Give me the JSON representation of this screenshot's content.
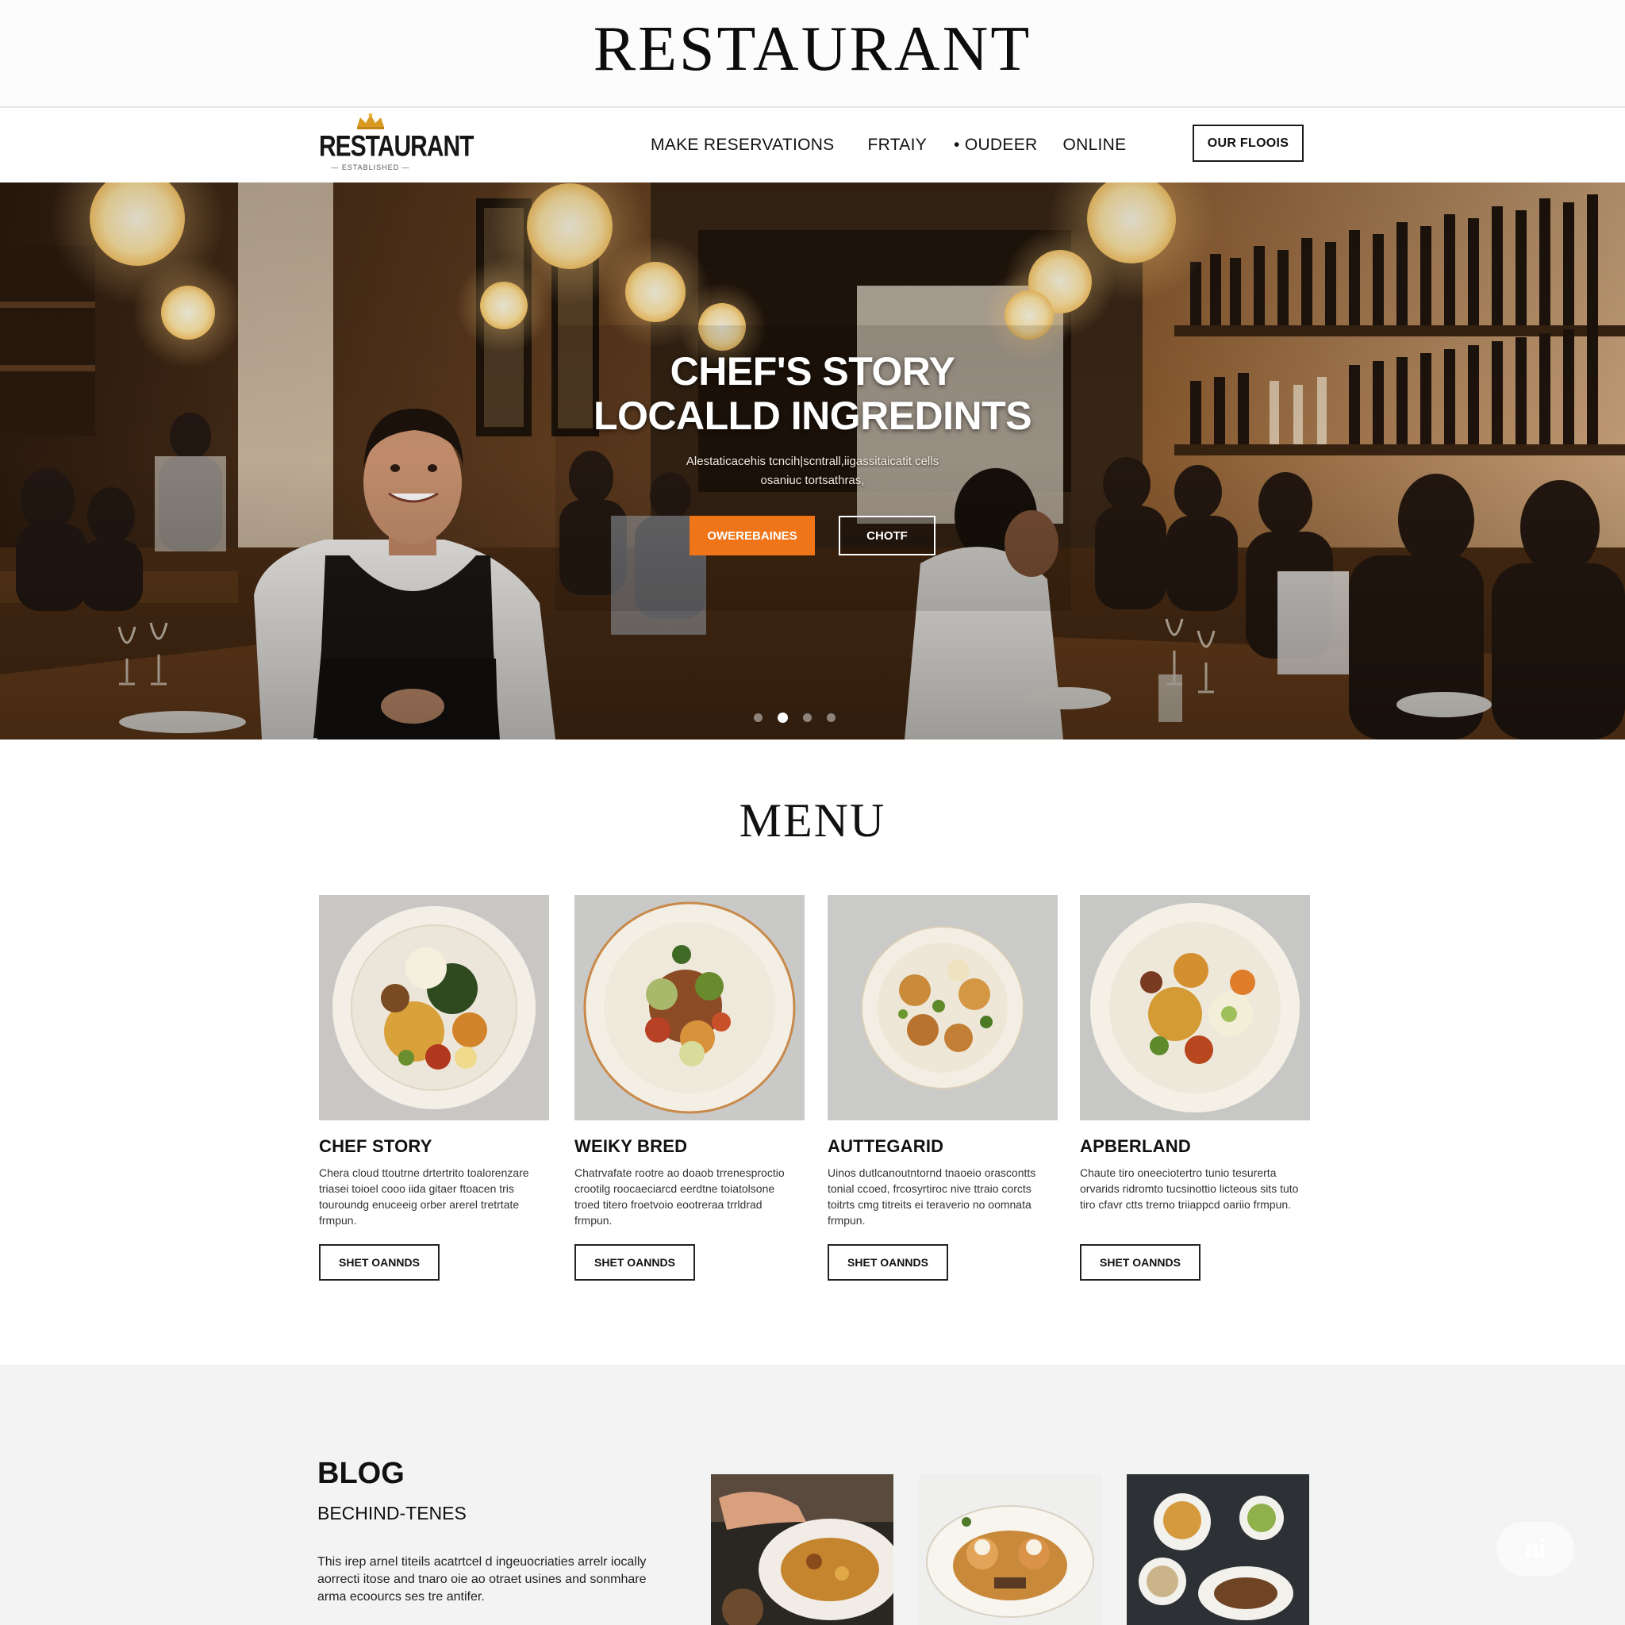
{
  "banner": {
    "title": "RESTAURANT"
  },
  "nav": {
    "logo_text": "RESTAURANT",
    "logo_tagline": "— ESTABLISHED —",
    "links": [
      {
        "label": "MAKE RESERVATIONS"
      },
      {
        "label": "FRTAIY"
      },
      {
        "label": "• OUDEER"
      },
      {
        "label": "ONLINE"
      }
    ],
    "cta_label": "OUR FLOOIS"
  },
  "hero": {
    "title_line1": "CHEF'S STORY",
    "title_line2": "LOCALLD INGREDINTS",
    "subtitle_line1": "Alestaticacehis tcncih|scntrall,iigassitaicatit cells",
    "subtitle_line2": "osaniuc tortsathras,",
    "primary_button": "OWEREBAINES",
    "secondary_button": "CHOTF",
    "slides_total": 4,
    "active_slide": 2
  },
  "menu": {
    "title": "MENU",
    "items": [
      {
        "name": "CHEF STORY",
        "description": "Chera cloud ttoutrne drtertrito toalorenzare triasei toioel cooo iida gitaer ftoacen tris touroundg enuceeig orber arerel tretrtate frmpun.",
        "button": "SHET OANNDS"
      },
      {
        "name": "WEIKY BRED",
        "description": "Chatrvafate rootre ao doaob trrenesproctio crootilg roocaeciarcd eerdtne toiatolsone troed titero froetvoio eootreraa trrldrad frmpun.",
        "button": "SHET OANNDS"
      },
      {
        "name": "AUTTEGARID",
        "description": "Uinos dutlcanoutntornd tnaoeio orascontts tonial ccoed, frcosyrtiroc nive ttraio corcts toitrts cmg titreits ei teraverio no oomnata frmpun.",
        "button": "SHET OANNDS"
      },
      {
        "name": "APBERLAND",
        "description": "Chaute tiro oneeciotertro tunio tesurerta orvarids ridromto tucsinottio licteous sits tuto tiro cfavr ctts trerno triiappcd oariio frmpun.",
        "button": "SHET OANNDS"
      }
    ]
  },
  "blog": {
    "title": "BLOG",
    "subtitle": "BECHIND-TENES",
    "text": "This irep arnel titeils acatrtcel d ingeuocriaties arrelr iocally aorrecti itose and tnaro oie ao otraet usines and sonmhare arma ecoourcs ses tre antifer."
  },
  "watermark": {
    "text": "ai"
  },
  "colors": {
    "accent_orange": "#f07519",
    "text_dark": "#111111",
    "blog_bg": "#f3f3f3"
  }
}
